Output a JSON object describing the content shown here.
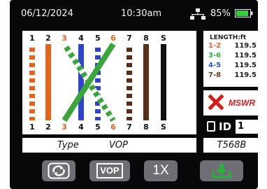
{
  "status": {
    "date": "06/12/2024",
    "time": "10:30am",
    "battery": "85%"
  },
  "pins": [
    "1",
    "2",
    "3",
    "4",
    "5",
    "6",
    "7",
    "8",
    "S"
  ],
  "length": {
    "header": "LENGTH:ft",
    "rows": [
      {
        "pair": "1-2",
        "value": "119.5",
        "color": "#e8631a"
      },
      {
        "pair": "3-6",
        "value": "119.5",
        "color": "#2fa83a"
      },
      {
        "pair": "4-5",
        "value": "119.5",
        "color": "#2a57c4"
      },
      {
        "pair": "7-8",
        "value": "119.5",
        "color": "#6b3a1d"
      }
    ]
  },
  "mswr": {
    "label": "MSWR"
  },
  "id": {
    "label": "ID",
    "value": "1"
  },
  "type": {
    "label": "Type",
    "value": "VOP"
  },
  "standard": "T568B",
  "buttons": {
    "vop": "VOP",
    "speed": "1X"
  },
  "colors": {
    "orange": "#e8631a",
    "green": "#3aa63a",
    "blue": "#2f45c8",
    "brown": "#5a2d17",
    "black": "#111111",
    "alert": "#d91a1a",
    "button": "#6e6e74",
    "save_green": "#25b339"
  }
}
